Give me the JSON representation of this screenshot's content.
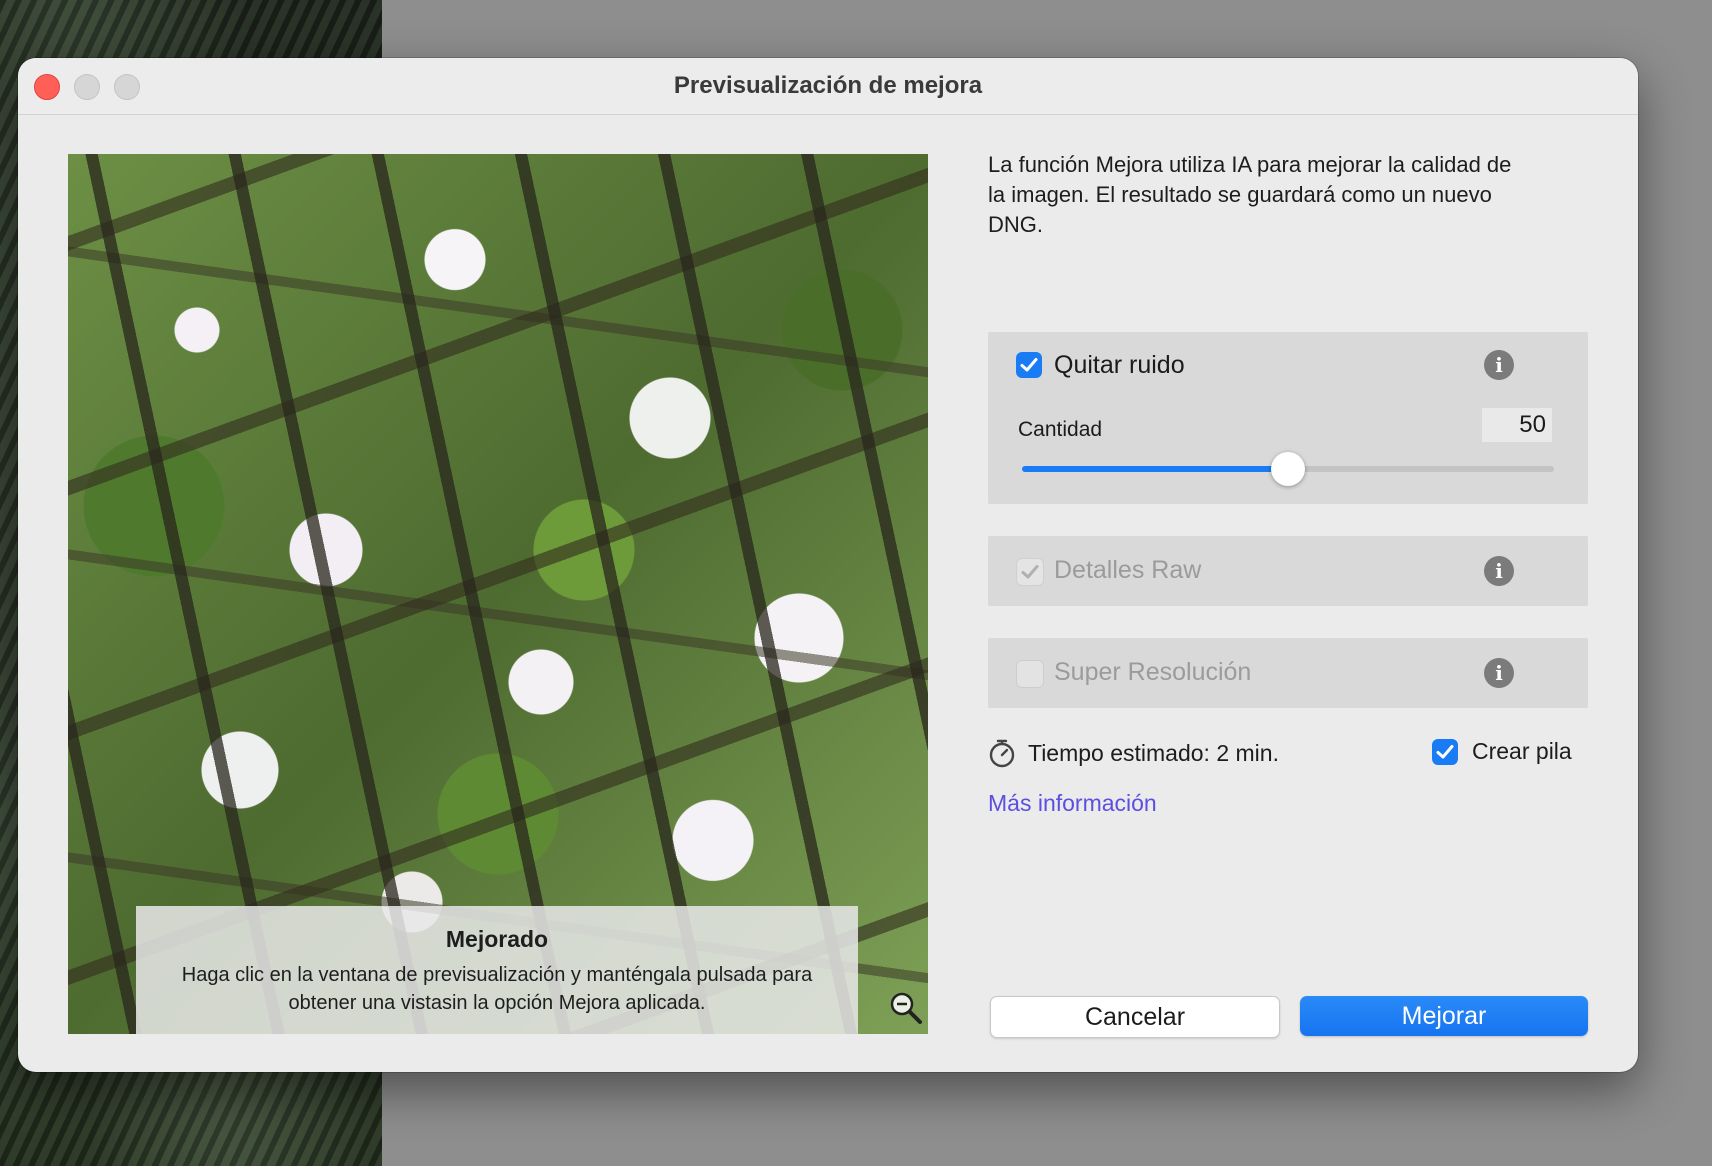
{
  "window": {
    "title": "Previsualización de mejora"
  },
  "preview": {
    "caption_title": "Mejorado",
    "caption_text": "Haga clic en la ventana de previsualización y manténgala pulsada para obtener una vistasin la opción Mejora aplicada."
  },
  "description": {
    "lines": [
      "La función Mejora utiliza IA para mejorar la calidad de",
      "la imagen. El resultado se guardará como un nuevo",
      "DNG."
    ]
  },
  "options": {
    "noise": {
      "label": "Quitar ruido",
      "checked": true
    },
    "amount": {
      "label": "Cantidad",
      "value": "50",
      "level": 50,
      "max": 100
    },
    "raw": {
      "label": "Detalles Raw",
      "checked": true,
      "disabled": true
    },
    "super": {
      "label": "Super Resolución",
      "checked": false,
      "disabled": true
    }
  },
  "estimate": {
    "label": "Tiempo estimado: 2 min."
  },
  "stack": {
    "label": "Crear pila",
    "checked": true
  },
  "more_info": "Más información",
  "buttons": {
    "cancel": "Cancelar",
    "enhance": "Mejorar"
  },
  "colors": {
    "accent": "#1a7cf5",
    "link": "#5b4fe0",
    "close": "#ff5f57"
  },
  "icons": {
    "info": "info-icon",
    "timer": "stopwatch-icon",
    "zoom": "zoom-out-icon",
    "check": "checkmark-icon"
  }
}
